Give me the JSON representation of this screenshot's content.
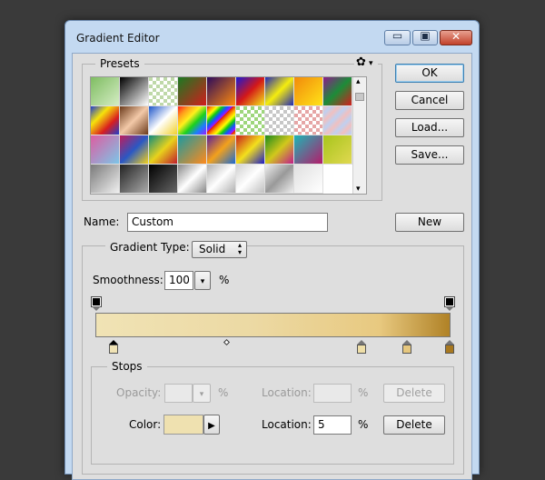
{
  "window": {
    "title": "Gradient Editor"
  },
  "window_controls": {
    "minimize": "▭",
    "restore": "▣",
    "close": "✕"
  },
  "presets": {
    "label": "Presets",
    "gear": "✿",
    "gear_arrow": "▾",
    "scroll_up": "▴",
    "scroll_down": "▾",
    "swatches": [
      "linear-gradient(135deg,#7fbd62,#d4ecc3)",
      "linear-gradient(135deg,#000,#fff)",
      "repeating-conic-gradient(#fff 0 25%, #bfd9a9 0 50%) 0 0/8px 8px",
      "linear-gradient(135deg,#1a7a22,#d21c1c)",
      "linear-gradient(135deg,#2c0a5b,#ff8b0c)",
      "linear-gradient(135deg,#1a18d4,#d41818,#f3e91a)",
      "linear-gradient(135deg,#2229b5,#f5ed0e,#2229b5)",
      "linear-gradient(135deg,#f28a0b,#ffe318)",
      "linear-gradient(135deg,#8c1d8c,#1c8c38,#d41d1d)",
      "linear-gradient(135deg,#1d3ecf,#f6e30b,#d91e1e,#1d3ecf)",
      "linear-gradient(135deg,#6b3a1b,#f3c9a8,#6b3a1b)",
      "linear-gradient(135deg,#1c55c9,#fff,#f2d02b)",
      "linear-gradient(135deg,#ff1c1c,#ff9b1c,#fff01c,#1cd11c,#1c7dff,#9b1cff)",
      "repeating-linear-gradient(135deg,#d11,#f90 4px,#ff0 8px,#1c1 12px,#15f 16px,#a1f 20px)",
      "repeating-conic-gradient(#fff 0 25%, #9ed67c 0 50%) 0 0/8px 8px",
      "repeating-conic-gradient(#fff 0 25%, #c7c7c7 0 50%) 0 0/8px 8px",
      "repeating-conic-gradient(#fff 0 25%, #e6a6a6 0 50%) 0 0/8px 8px",
      "repeating-linear-gradient(135deg,#f0c0c0,#c0d0f0 6px,#f0c0c0 12px)",
      "linear-gradient(135deg,#dd5da1,#7cc6e8)",
      "linear-gradient(135deg,#c01c5b,#2a58c4,#f3d21c)",
      "linear-gradient(135deg,#0e8a7e,#e8d21c,#c01c2a)",
      "linear-gradient(135deg,#1a9aa1,#ff8a1c)",
      "linear-gradient(135deg,#5a1c9a,#f3a11c,#1c6ad1)",
      "linear-gradient(135deg,#c71c1c,#f3e01c,#1c1cc7)",
      "linear-gradient(135deg,#1c8a1c,#d1c81c,#c01c8a)",
      "linear-gradient(135deg,#1cb5b5,#b51c6b)",
      "linear-gradient(135deg,#a8c51c,#e0d850)",
      "linear-gradient(135deg,#7a7a7a,#f0f0f0)",
      "linear-gradient(135deg,#222,#aaa)",
      "linear-gradient(135deg,#000,#666)",
      "linear-gradient(135deg,#888,#fff,#888)",
      "linear-gradient(135deg,#b0b0b0,#fff,#b0b0b0)",
      "linear-gradient(135deg,#d0d0d0,#fff,#c0c0c0)",
      "linear-gradient(135deg,#eee,#999,#eee)",
      "linear-gradient(135deg,#e0e0e0,#fff)"
    ]
  },
  "buttons": {
    "ok": "OK",
    "cancel": "Cancel",
    "load": "Load...",
    "save": "Save...",
    "new": "New"
  },
  "name": {
    "label": "Name:",
    "value": "Custom"
  },
  "gradient_type": {
    "label": "Gradient Type:",
    "value": "Solid",
    "spinner": "▴▾"
  },
  "smoothness": {
    "label": "Smoothness:",
    "value": "100",
    "dropdown": "▾",
    "unit": "%"
  },
  "gradient": {
    "css": "linear-gradient(90deg,#f0e3b5 0%,#ecd9a3 45%,#e8c980 80%,#b08226 100%)",
    "opacity_stops": [
      0,
      100
    ],
    "color_stops": [
      {
        "location": 5,
        "color": "#f0e3b5",
        "selected": true
      },
      {
        "location": 75,
        "color": "#efdfa8",
        "selected": false
      },
      {
        "location": 88,
        "color": "#e6c77e",
        "selected": false
      },
      {
        "location": 100,
        "color": "#a8781f",
        "selected": false
      }
    ],
    "midpoint": 37
  },
  "stops": {
    "label": "Stops",
    "opacity_label": "Opacity:",
    "opacity_unit": "%",
    "opacity_dropdown": "▾",
    "opacity_location_label": "Location:",
    "opacity_location_unit": "%",
    "opacity_delete": "Delete",
    "color_label": "Color:",
    "color_value": "#efe1b0",
    "color_arrow": "▶",
    "color_location_label": "Location:",
    "color_location_value": "5",
    "color_location_unit": "%",
    "color_delete": "Delete"
  }
}
